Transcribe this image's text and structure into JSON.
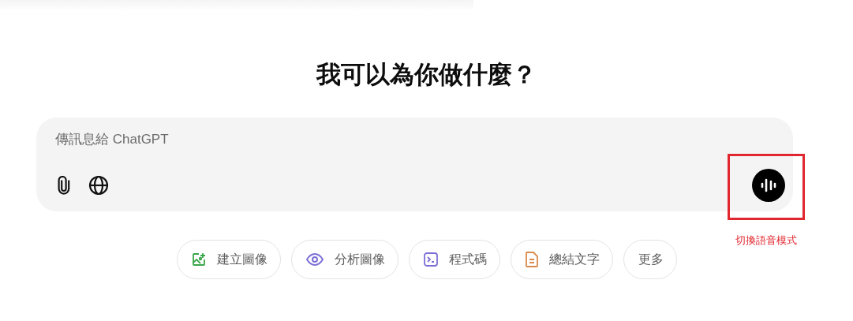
{
  "heading": "我可以為你做什麼？",
  "composer": {
    "placeholder": "傳訊息給 ChatGPT"
  },
  "annotation": {
    "label": "切換語音模式"
  },
  "chips": [
    {
      "kind": "image",
      "label": "建立圖像",
      "color": "#3aa64a"
    },
    {
      "kind": "eye",
      "label": "分析圖像",
      "color": "#7b6fd6"
    },
    {
      "kind": "code",
      "label": "程式碼",
      "color": "#7b6fd6"
    },
    {
      "kind": "doc",
      "label": "總結文字",
      "color": "#d98a4a"
    },
    {
      "kind": "text",
      "label": "更多"
    }
  ]
}
